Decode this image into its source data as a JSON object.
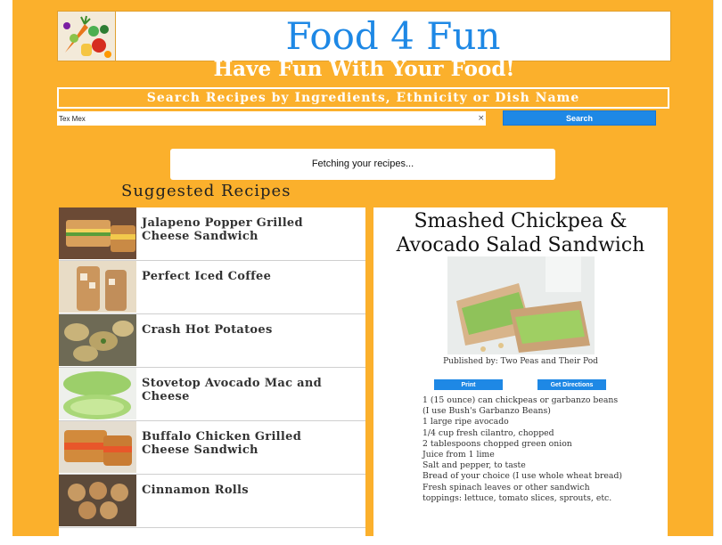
{
  "site": {
    "title": "Food 4 Fun",
    "tagline": "Have Fun With Your Food!",
    "search_label": "Search Recipes by Ingredients, Ethnicity or Dish Name"
  },
  "search": {
    "value": "Tex Mex",
    "clear_icon": "×",
    "button_label": "Search"
  },
  "status_message": "Fetching your recipes...",
  "suggested": {
    "heading": "Suggested Recipes",
    "items": [
      {
        "title": "Jalapeno Popper Grilled Cheese Sandwich"
      },
      {
        "title": "Perfect Iced Coffee"
      },
      {
        "title": "Crash Hot Potatoes"
      },
      {
        "title": "Stovetop Avocado Mac and Cheese"
      },
      {
        "title": "Buffalo Chicken Grilled Cheese Sandwich"
      },
      {
        "title": "Cinnamon Rolls"
      }
    ]
  },
  "detail": {
    "title": "Smashed Chickpea & Avocado Salad Sandwich",
    "publisher": "Published by: Two Peas and Their Pod",
    "print_label": "Print",
    "directions_label": "Get Directions",
    "ingredients": [
      "1 (15 ounce) can chickpeas or garbanzo beans (I use Bush's Garbanzo Beans)",
      "1 large ripe avocado",
      "1/4 cup fresh cilantro, chopped",
      "2 tablespoons chopped green onion",
      "Juice from 1 lime",
      "Salt and pepper, to taste",
      "Bread of your choice (I use whole wheat bread)",
      "Fresh spinach leaves or other sandwich toppings: lettuce, tomato slices, sprouts, etc."
    ]
  },
  "colors": {
    "background": "#fbb02c",
    "accent": "#1e88e5"
  }
}
